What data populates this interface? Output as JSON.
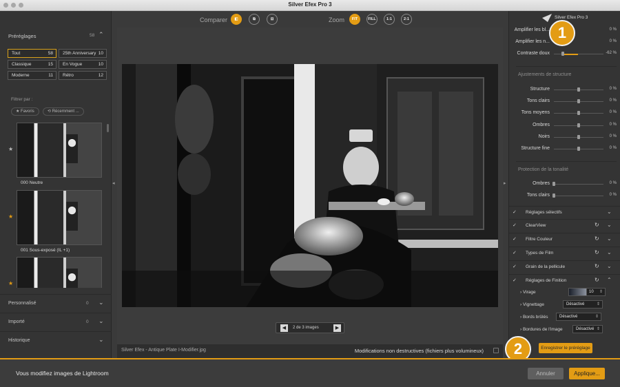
{
  "window": {
    "title": "Silver Efex Pro 3"
  },
  "left_panel": {
    "presets": {
      "label": "Préréglages",
      "count": "58"
    },
    "categories": [
      {
        "name": "Tout",
        "count": "58"
      },
      {
        "name": "25th Anniversary",
        "count": "10"
      },
      {
        "name": "Classique",
        "count": "15"
      },
      {
        "name": "En Vogue",
        "count": "10"
      },
      {
        "name": "Moderne",
        "count": "11"
      },
      {
        "name": "Rétro",
        "count": "12"
      }
    ],
    "filter_label": "Filtrer par :",
    "filter_chips": [
      "★ Favoris",
      "⟲ Récemment ..."
    ],
    "thumbnails": [
      {
        "name": "000 Neutre",
        "starred": false
      },
      {
        "name": "001 Sous-exposé (IL +1)",
        "starred": true
      },
      {
        "name": "",
        "starred": true
      }
    ],
    "sections": [
      {
        "label": "Personnalisé",
        "meta": "0"
      },
      {
        "label": "Importé",
        "meta": "0"
      },
      {
        "label": "Historique",
        "meta": ""
      }
    ]
  },
  "toolbar": {
    "compare_label": "Comparer",
    "zoom_label": "Zoom",
    "zoom_options": [
      "FIT",
      "FILL",
      "1:1",
      "2:1"
    ]
  },
  "pager": {
    "text": "2 de 3 images"
  },
  "status": {
    "filename": "Silver Efex - Antique Plate I-Modifier.jpg",
    "non_destructive": "Modifications non destructives (fichiers plus volumineux)"
  },
  "right_panel": {
    "brand": "Silver Efex Pro 3",
    "top_sliders": [
      {
        "label": "Amplifier les bl...",
        "value": "0 %"
      },
      {
        "label": "Amplifier les n...",
        "value": "0 %"
      },
      {
        "label": "Contraste doux",
        "value": "-62 %"
      }
    ],
    "structure_title": "Ajustements de structure",
    "structure_sliders": [
      {
        "label": "Structure",
        "value": "0 %"
      },
      {
        "label": "Tons clairs",
        "value": "0 %"
      },
      {
        "label": "Tons moyens",
        "value": "0 %"
      },
      {
        "label": "Ombres",
        "value": "0 %"
      },
      {
        "label": "Noirs",
        "value": "0 %"
      },
      {
        "label": "Structure fine",
        "value": "0 %"
      }
    ],
    "tonality_title": "Protection de la tonalité",
    "tonality_sliders": [
      {
        "label": "Ombres",
        "value": "0 %"
      },
      {
        "label": "Tons clairs",
        "value": "0 %"
      }
    ],
    "filters": [
      {
        "label": "Réglages sélectifs"
      },
      {
        "label": "ClearView"
      },
      {
        "label": "Filtre Couleur"
      },
      {
        "label": "Types de Film"
      },
      {
        "label": "Grain de la pellicule"
      },
      {
        "label": "Réglages de Finition"
      }
    ],
    "finishing": [
      {
        "label": "› Virage",
        "value": "10"
      },
      {
        "label": "› Vignettage",
        "value": "Désactivé"
      },
      {
        "label": "› Bords brûlés",
        "value": "Désactivé"
      },
      {
        "label": "› Bordures de l'image",
        "value": "Désactivé"
      }
    ],
    "save_button": "Enregistrer le préréglage"
  },
  "callouts": [
    "1",
    "2"
  ],
  "footer": {
    "message": "Vous modifiez images de Lightroom",
    "cancel": "Annuler",
    "apply": "Applique..."
  },
  "colors": {
    "accent": "#e39c14",
    "panel": "#343434",
    "background": "#3c3c3c"
  }
}
